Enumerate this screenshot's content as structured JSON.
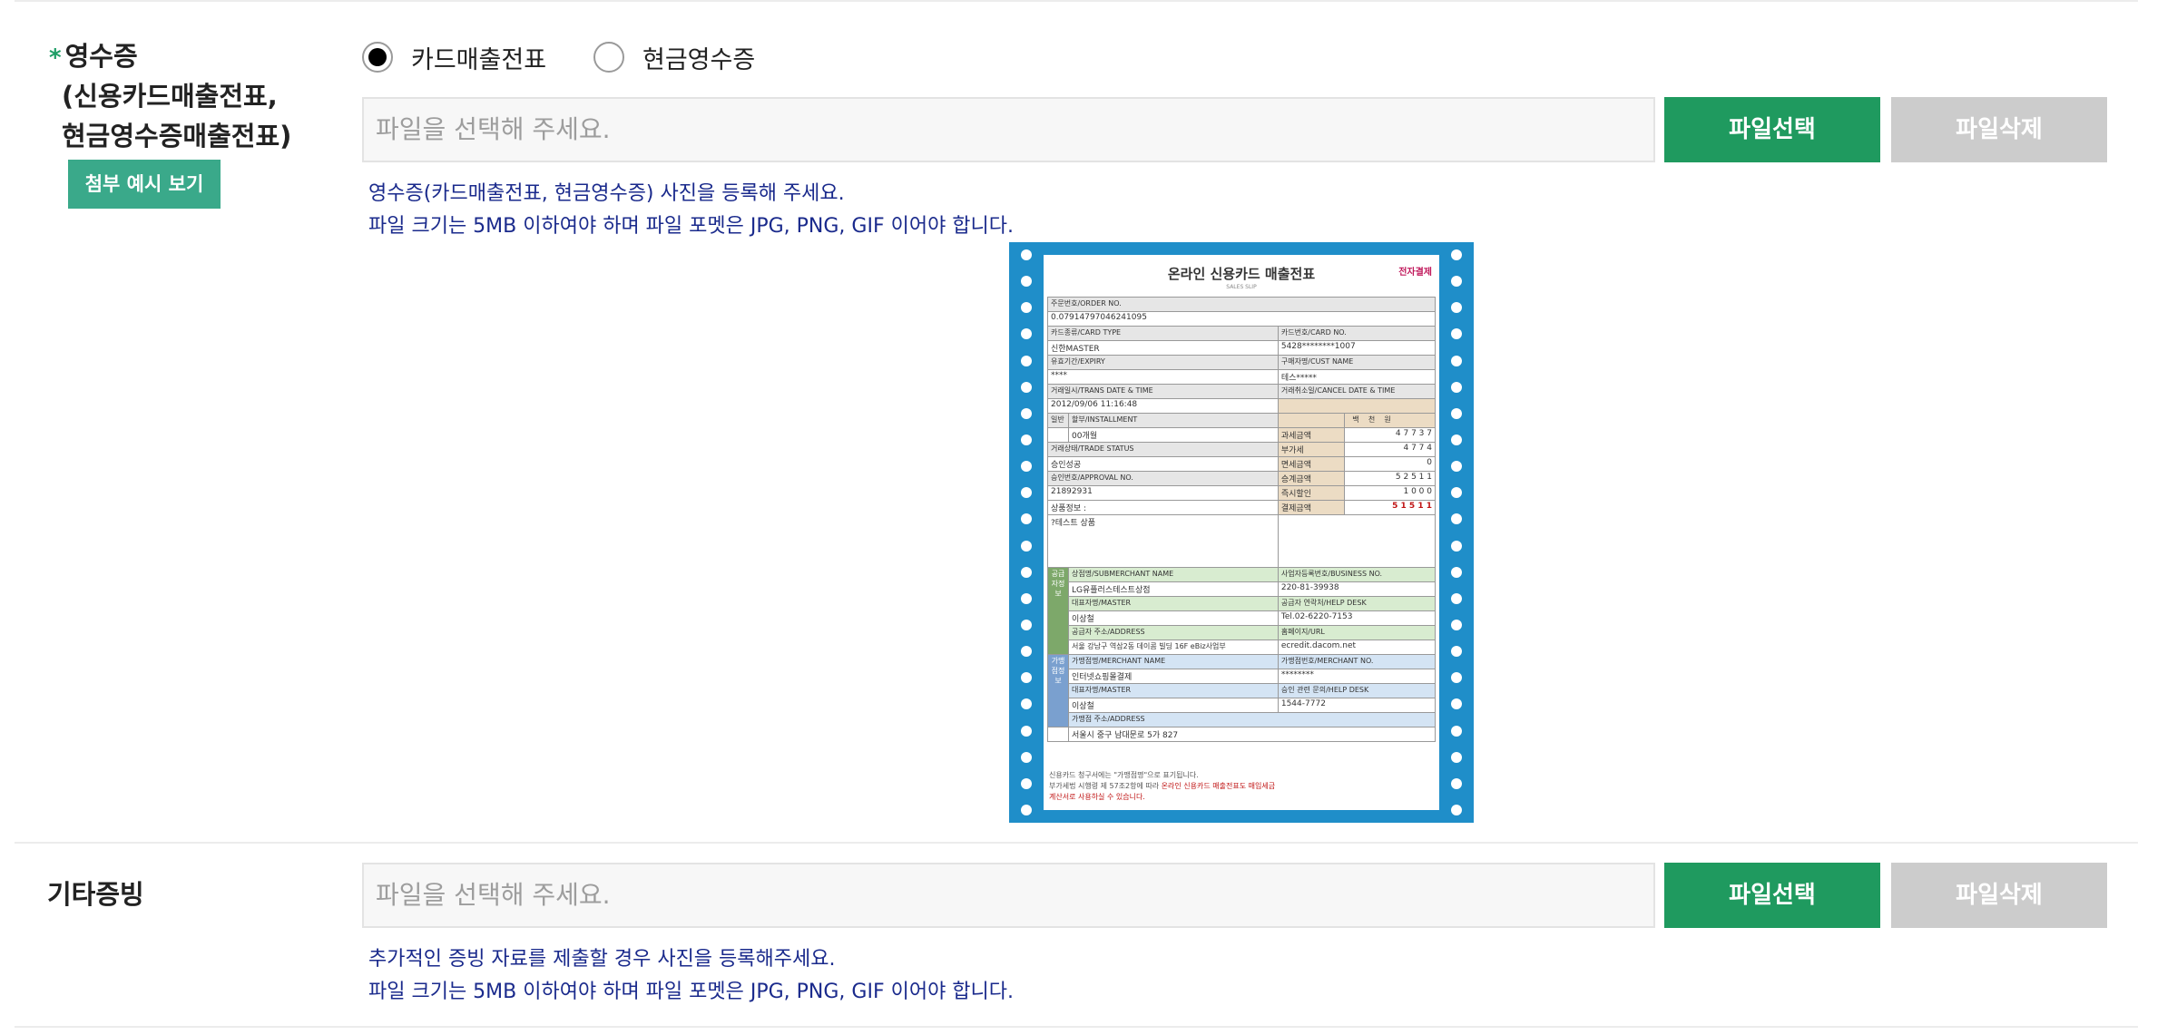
{
  "receipt_section": {
    "required_mark": "*",
    "label_line1": "영수증",
    "label_line2": "(신용카드매출전표,",
    "label_line3": "현금영수증매출전표)",
    "example_button": "첨부 예시 보기",
    "radio_card": "카드매출전표",
    "radio_card_selected": true,
    "radio_cash": "현금영수증",
    "file_placeholder": "파일을 선택해 주세요.",
    "select_button": "파일선택",
    "delete_button": "파일삭제",
    "help_line1": "영수증(카드매출전표, 현금영수증) 사진을 등록해 주세요.",
    "help_line2": "파일 크기는 5MB 이하여야 하며 파일 포멧은 JPG, PNG, GIF 이어야 합니다."
  },
  "receipt_image": {
    "title": "온라인 신용카드 매출전표",
    "subtitle": "SALES SLIP",
    "logo": "전자결제",
    "order_no_label": "주문번호/ORDER NO.",
    "order_no": "0.07914797046241095",
    "card_type_label": "카드종류/CARD TYPE",
    "card_type": "신한MASTER",
    "card_no_label": "카드번호/CARD NO.",
    "card_no": "5428********1007",
    "expiry_label": "유효기간/EXPIRY",
    "expiry": "****",
    "cust_name_label": "구매자명/CUST NAME",
    "cust_name": "테스*****",
    "trans_date_label": "거래일시/TRANS DATE & TIME",
    "trans_date": "2012/09/06 11:16:48",
    "cancel_date_label": "거래취소일/CANCEL DATE & TIME",
    "general_label": "일반",
    "installment_label": "할부/INSTALLMENT",
    "installment": "00개월",
    "status_label": "거래상태/TRADE STATUS",
    "status": "승인성공",
    "approval_label": "승인번호/APPROVAL NO.",
    "approval": "21892931",
    "product_label": "상품정보 :",
    "product": "?테스트 상품",
    "unit_headers": [
      "백",
      "천",
      "원"
    ],
    "amount_rows": [
      {
        "label": "과세금액",
        "digits": "4 7 7 3 7"
      },
      {
        "label": "부가세",
        "digits": "4 7 7 4"
      },
      {
        "label": "면세금액",
        "digits": "0"
      },
      {
        "label": "승계금액",
        "digits": "5 2 5 1 1"
      },
      {
        "label": "즉시할인",
        "digits": "1 0 0 0"
      },
      {
        "label": "결제금액",
        "digits": "5 1 5 1 1"
      }
    ],
    "supplier_side": "공급자정보",
    "sub_merchant_label": "상점명/SUBMERCHANT NAME",
    "sub_merchant": "LG유플러스테스트상점",
    "biz_no_label": "사업자등록번호/BUSINESS NO.",
    "biz_no": "220-81-39938",
    "master_label": "대표자명/MASTER",
    "master": "이상철",
    "help_desk_label": "공급자 연락처/HELP DESK",
    "help_desk": "Tel.02-6220-7153",
    "address_label": "공급자 주소/ADDRESS",
    "address": "서울 강남구 역삼2동 데이콤 빌딩 16F eBiz사업부",
    "url_label": "홈페이지/URL",
    "url": "ecredit.dacom.net",
    "merchant_side": "가맹점정보",
    "merchant_name_label": "가맹점명/MERCHANT NAME",
    "merchant_name": "인터넷쇼핑몰결제",
    "merchant_no_label": "가맹점번호/MERCHANT NO.",
    "merchant_no": "********",
    "m_master_label": "대표자명/MASTER",
    "m_master": "이상철",
    "m_help_label": "승인 관련 문의/HELP DESK",
    "m_help": "1544-7772",
    "m_address_label": "가맹점 주소/ADDRESS",
    "m_address": "서울시 중구 남대문로 5가 827",
    "footer1": "신용카드 청구서에는 \"가맹점명\"으로 표기됩니다.",
    "footer2a": "부가세법 시행령 제 57조2항에 따라 ",
    "footer2b": "온라인 신용카드 매출전표도 매입세금",
    "footer3": "계산서로 사용하실 수 있습니다."
  },
  "other_section": {
    "label": "기타증빙",
    "file_placeholder": "파일을 선택해 주세요.",
    "select_button": "파일선택",
    "delete_button": "파일삭제",
    "help_line1": "추가적인 증빙 자료를 제출할 경우 사진을 등록해주세요.",
    "help_line2": "파일 크기는 5MB 이하여야 하며 파일 포멧은 JPG, PNG, GIF 이어야 합니다."
  }
}
